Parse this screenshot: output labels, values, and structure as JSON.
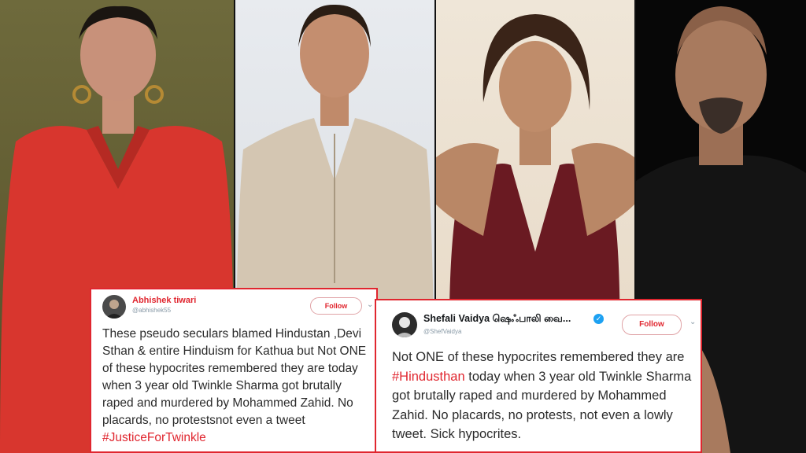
{
  "tweet_left": {
    "user_name": "Abhishek tiwari",
    "user_handle": "@abhishek55",
    "follow_label": "Follow",
    "text_part1": "These pseudo seculars blamed Hindustan ,Devi Sthan & entire Hinduism for Kathua but Not ONE of these hypocrites remembered they are today when 3 year old Twinkle Sharma got brutally raped and murdered by Mohammed Zahid. No placards, no protestsnot even a tweet ",
    "hashtag": "#JusticeForTwinkle"
  },
  "tweet_right": {
    "user_name": "Shefali Vaidya ஷெஃபாலி வை...",
    "user_handle": "@ShefVaidya",
    "follow_label": "Follow",
    "text_part1": "Not ONE of these hypocrites remembered they are ",
    "hashtag": "#Hindusthan",
    "text_part2": " today when 3 year old Twinkle Sharma got brutally raped and murdered by Mohammed Zahid. No placards, no protests, not even a lowly tweet. Sick hypocrites."
  },
  "colors": {
    "accent_red": "#e0262f",
    "verified_blue": "#1da1f2"
  },
  "icons": [
    "verified-badge-icon",
    "chevron-down-icon"
  ]
}
